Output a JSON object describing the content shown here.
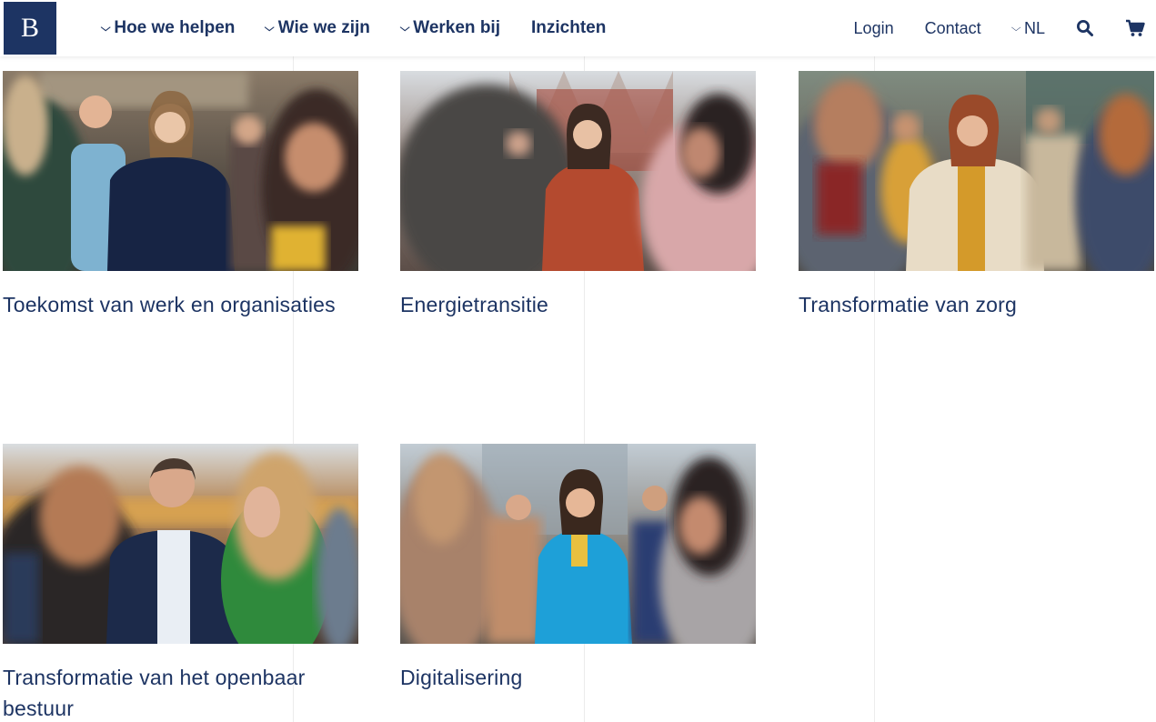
{
  "header": {
    "logo_letter": "B",
    "nav": [
      {
        "label": "Hoe we helpen",
        "has_dropdown": true
      },
      {
        "label": "Wie we zijn",
        "has_dropdown": true
      },
      {
        "label": "Werken bij",
        "has_dropdown": true
      },
      {
        "label": "Inzichten",
        "has_dropdown": false
      }
    ],
    "login_label": "Login",
    "contact_label": "Contact",
    "language_label": "NL",
    "search_icon": "search-icon",
    "cart_icon": "cart-icon"
  },
  "cards": [
    {
      "title": "Toekomst van werk en organisaties"
    },
    {
      "title": "Energietransitie"
    },
    {
      "title": "Transformatie van zorg"
    },
    {
      "title": "Transformatie van het openbaar bestuur"
    },
    {
      "title": "Digitalisering"
    }
  ],
  "colors": {
    "brand_navy": "#1d3463",
    "background": "#ffffff"
  }
}
